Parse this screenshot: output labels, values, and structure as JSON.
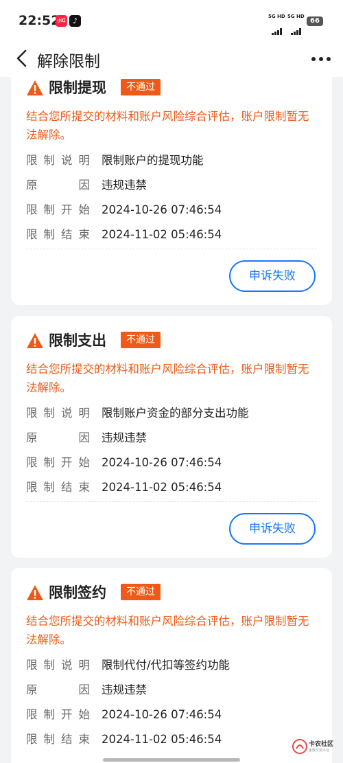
{
  "status_bar": {
    "time": "22:52",
    "app_icons": [
      "xiaohongshu-icon",
      "tiktok-icon"
    ],
    "signal1": "5G HD",
    "signal2": "5G HD",
    "battery": "66"
  },
  "header": {
    "back_icon": "chevron-left-icon",
    "title": "解除限制",
    "more_icon": "more-dots-icon"
  },
  "cards": [
    {
      "title": "限制提现",
      "badge": "不通过",
      "desc": "结合您所提交的材料和账户风险综合评估，账户限制暂无法解除。",
      "rows": [
        {
          "key": "限制说明",
          "value": "限制账户的提现功能"
        },
        {
          "key": "原因",
          "value": "违规违禁"
        },
        {
          "key": "限制开始",
          "value": "2024-10-26 07:46:54"
        },
        {
          "key": "限制结束",
          "value": "2024-11-02 05:46:54"
        }
      ],
      "button": "申诉失败"
    },
    {
      "title": "限制支出",
      "badge": "不通过",
      "desc": "结合您所提交的材料和账户风险综合评估，账户限制暂无法解除。",
      "rows": [
        {
          "key": "限制说明",
          "value": "限制账户资金的部分支出功能"
        },
        {
          "key": "原因",
          "value": "违规违禁"
        },
        {
          "key": "限制开始",
          "value": "2024-10-26 07:46:54"
        },
        {
          "key": "限制结束",
          "value": "2024-11-02 05:46:54"
        }
      ],
      "button": "申诉失败"
    },
    {
      "title": "限制签约",
      "badge": "不通过",
      "desc": "结合您所提交的材料和账户风险综合评估，账户限制暂无法解除。",
      "rows": [
        {
          "key": "限制说明",
          "value": "限制代付/代扣等签约功能"
        },
        {
          "key": "原因",
          "value": "违规违禁"
        },
        {
          "key": "限制开始",
          "value": "2024-10-26 07:46:54"
        },
        {
          "key": "限制结束",
          "value": "2024-11-02 05:46:54"
        }
      ]
    }
  ],
  "watermark": {
    "text": "卡农社区",
    "sub": "金融交流平台"
  },
  "colors": {
    "accent_orange": "#ef5a18",
    "primary_blue": "#1677ff",
    "background": "#f2f3f5"
  }
}
